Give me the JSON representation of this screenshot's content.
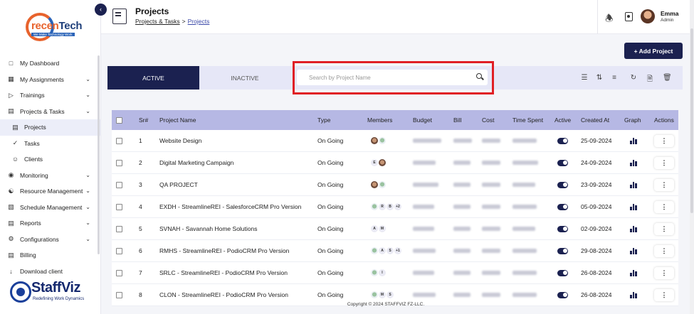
{
  "brand": {
    "top_logo_text_prefix": "recen",
    "top_logo_text_suffix": "Tech",
    "top_logo_tagline": "We Make Technology Work",
    "bottom_logo_name": "StaffViz",
    "bottom_logo_tagline": "Redefining Work Dynamics"
  },
  "sidebar": {
    "items": [
      {
        "label": "My Dashboard",
        "icon": "dashboard-icon",
        "chevron": false
      },
      {
        "label": "My Assignments",
        "icon": "assignments-icon",
        "chevron": true
      },
      {
        "label": "Trainings",
        "icon": "play-icon",
        "chevron": true
      },
      {
        "label": "Projects & Tasks",
        "icon": "clipboard-icon",
        "chevron": true
      },
      {
        "label": "Projects",
        "icon": "projects-icon",
        "chevron": false,
        "sub": true,
        "active": true
      },
      {
        "label": "Tasks",
        "icon": "check-circle-icon",
        "chevron": false,
        "sub": true
      },
      {
        "label": "Clients",
        "icon": "users-icon",
        "chevron": false,
        "sub": true
      },
      {
        "label": "Monitoring",
        "icon": "monitoring-icon",
        "chevron": true
      },
      {
        "label": "Resource Management",
        "icon": "resource-icon",
        "chevron": true
      },
      {
        "label": "Schedule Management",
        "icon": "calendar-icon",
        "chevron": true
      },
      {
        "label": "Reports",
        "icon": "reports-icon",
        "chevron": true
      },
      {
        "label": "Configurations",
        "icon": "gear-icon",
        "chevron": true
      },
      {
        "label": "Billing",
        "icon": "billing-icon",
        "chevron": false
      },
      {
        "label": "Download client",
        "icon": "download-icon",
        "chevron": false
      }
    ]
  },
  "header": {
    "title": "Projects",
    "breadcrumb_parent": "Projects & Tasks",
    "breadcrumb_separator": ">",
    "breadcrumb_current": "Projects",
    "user_name": "Emma",
    "user_role": "Admin"
  },
  "toolbar": {
    "add_label": "+ Add Project",
    "tab_active": "ACTIVE",
    "tab_inactive": "INACTIVE",
    "search_placeholder": "Search by Project Name",
    "search_value": ""
  },
  "table": {
    "columns": [
      "Sr#",
      "Project Name",
      "Type",
      "Members",
      "Budget",
      "Bill",
      "Cost",
      "Time Spent",
      "Active",
      "Created At",
      "Graph",
      "Actions"
    ],
    "rows": [
      {
        "sr": "1",
        "name": "Website Design",
        "type": "On Going",
        "members": [
          "img",
          "img2"
        ],
        "created": "25-09-2024"
      },
      {
        "sr": "2",
        "name": "Digital Marketing Campaign",
        "type": "On Going",
        "members": [
          "E",
          "img"
        ],
        "created": "24-09-2024"
      },
      {
        "sr": "3",
        "name": "QA PROJECT",
        "type": "On Going",
        "members": [
          "img",
          "img2"
        ],
        "created": "23-09-2024"
      },
      {
        "sr": "4",
        "name": "EXDH - StreamlineREI - SalesforceCRM Pro Version",
        "type": "On Going",
        "members": [
          "img2",
          "R",
          "B",
          "+2"
        ],
        "created": "05-09-2024"
      },
      {
        "sr": "5",
        "name": "SVNAH - Savannah Home Solutions",
        "type": "On Going",
        "members": [
          "A",
          "M"
        ],
        "created": "02-09-2024"
      },
      {
        "sr": "6",
        "name": "RMHS - StreamlineREI - PodioCRM Pro Version",
        "type": "On Going",
        "members": [
          "img2",
          "A",
          "S",
          "+1"
        ],
        "created": "29-08-2024"
      },
      {
        "sr": "7",
        "name": "SRLC - StreamlineREI - PodioCRM Pro Version",
        "type": "On Going",
        "members": [
          "img2",
          "I"
        ],
        "created": "26-08-2024"
      },
      {
        "sr": "8",
        "name": "CLON - StreamlineREI - PodioCRM Pro Version",
        "type": "On Going",
        "members": [
          "img2",
          "M",
          "S"
        ],
        "created": "26-08-2024"
      }
    ]
  },
  "footer": {
    "text": "Copyright © 2024 STAFFVIZ FZ-LLC."
  },
  "colors": {
    "primary": "#1b2150",
    "table_header": "#b6b8e4",
    "tab_strip": "#e6e7f7",
    "highlight": "#e01f25"
  }
}
